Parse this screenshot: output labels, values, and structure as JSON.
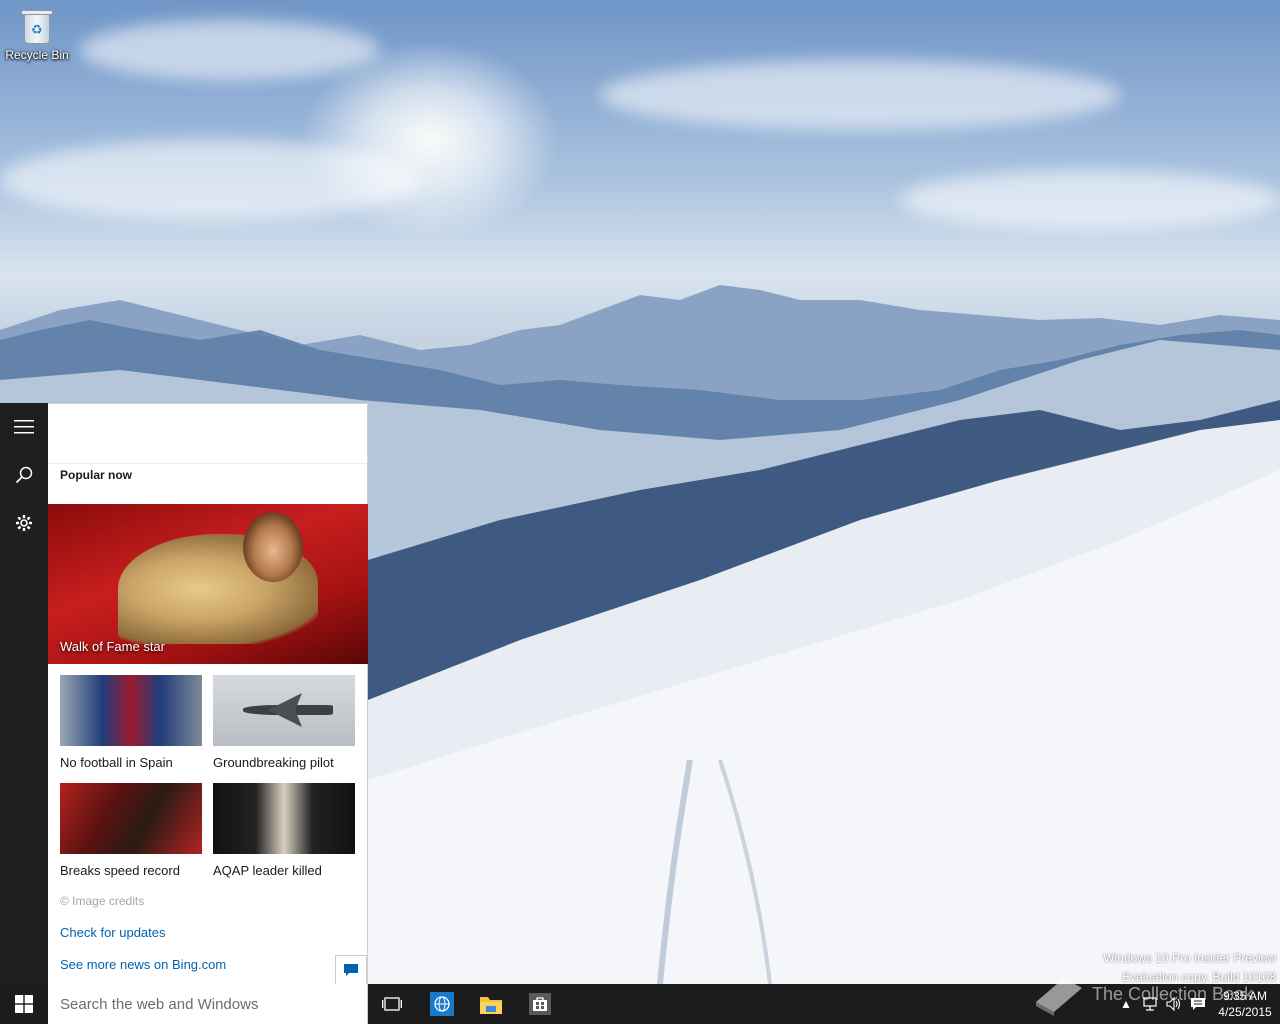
{
  "desktop": {
    "icons": [
      {
        "label": "Recycle Bin"
      }
    ],
    "watermark": {
      "line1": "Windows 10 Pro Insider Preview",
      "line2": "Evaluation copy. Build 10108"
    },
    "brand_watermark": "The Collection Book"
  },
  "cortana": {
    "rail": {
      "menu": "hamburger-icon",
      "search": "search-icon",
      "settings": "gear-icon"
    },
    "section_title": "Popular now",
    "hero": {
      "caption": "Walk of Fame star"
    },
    "news": [
      {
        "caption": "No football in Spain"
      },
      {
        "caption": "Groundbreaking pilot"
      },
      {
        "caption": "Breaks speed record"
      },
      {
        "caption": "AQAP leader killed"
      }
    ],
    "image_credits": "© Image credits",
    "check_updates": "Check for updates",
    "see_more": "See more news on Bing.com",
    "feedback_icon": "feedback-icon"
  },
  "taskbar": {
    "search_placeholder": "Search the web and Windows",
    "apps": [
      "task-view-icon",
      "internet-explorer-icon",
      "file-explorer-icon",
      "store-icon"
    ],
    "clock": {
      "time": "9:35 AM",
      "date": "4/25/2015"
    }
  },
  "colors": {
    "accent": "#0063b1",
    "taskbar": "#1c1c1c",
    "rail": "#1f1f1f"
  }
}
